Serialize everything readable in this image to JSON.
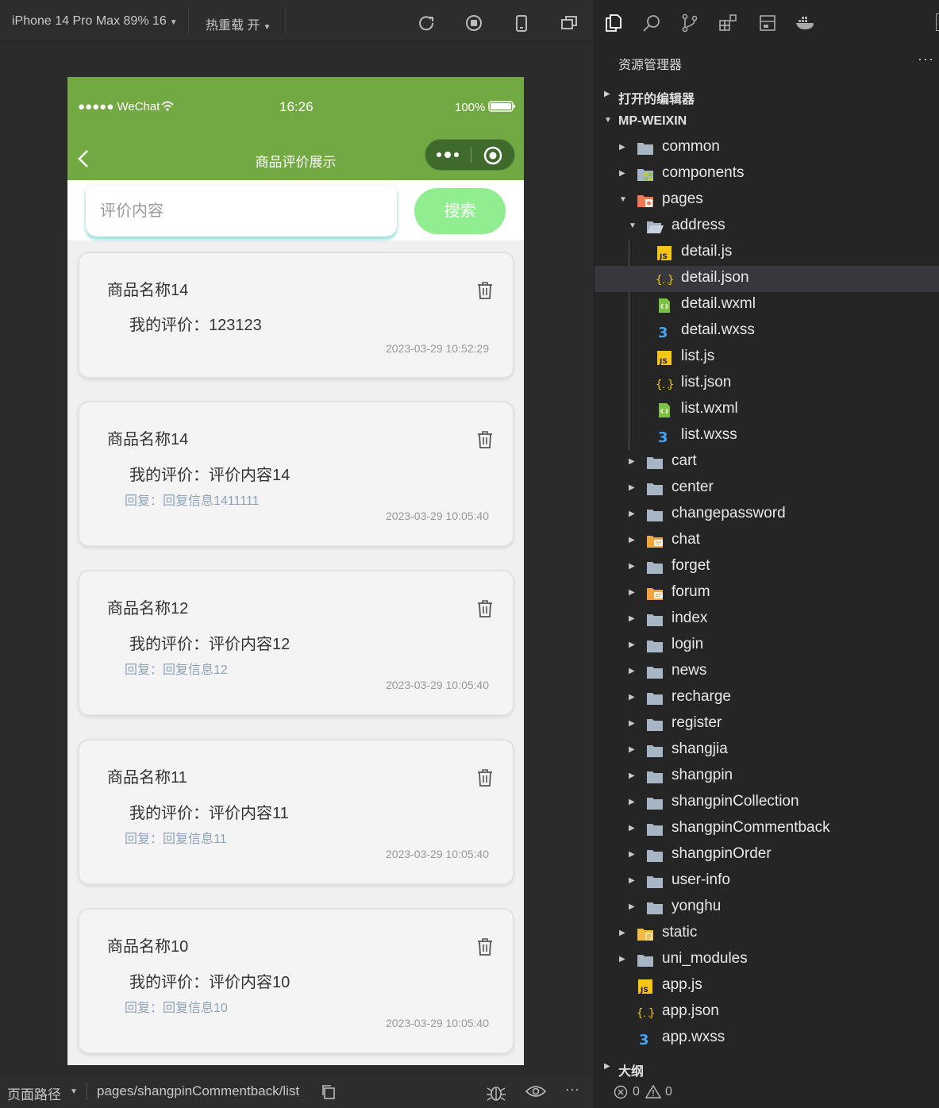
{
  "simulator": {
    "device_label": "iPhone 14 Pro Max 89% 16",
    "hot_reload_label": "热重载 开",
    "status_bar": {
      "carrier": "●●●●● WeChat",
      "time": "16:26",
      "battery": "100%"
    },
    "nav_title": "商品评价展示",
    "search": {
      "placeholder": "评价内容",
      "button": "搜索"
    },
    "comments": [
      {
        "name": "商品名称14",
        "mine": "我的评价：123123",
        "reply": "",
        "time": "2023-03-29 10:52:29"
      },
      {
        "name": "商品名称14",
        "mine": "我的评价：评价内容14",
        "reply": "回复：回复信息1411111",
        "time": "2023-03-29 10:05:40"
      },
      {
        "name": "商品名称12",
        "mine": "我的评价：评价内容12",
        "reply": "回复：回复信息12",
        "time": "2023-03-29 10:05:40"
      },
      {
        "name": "商品名称11",
        "mine": "我的评价：评价内容11",
        "reply": "回复：回复信息11",
        "time": "2023-03-29 10:05:40"
      },
      {
        "name": "商品名称10",
        "mine": "我的评价：评价内容10",
        "reply": "回复：回复信息10",
        "time": "2023-03-29 10:05:40"
      }
    ],
    "statusbar": {
      "path_label": "页面路径",
      "path": "pages/shangpinCommentback/list"
    }
  },
  "explorer": {
    "title": "资源管理器",
    "more": "···",
    "open_editors": "打开的编辑器",
    "project": "MP-WEIXIN",
    "outline": "大纲",
    "errors": "0",
    "warnings": "0",
    "tree": [
      {
        "label": "common",
        "type": "folder",
        "depth": 0,
        "expanded": false
      },
      {
        "label": "components",
        "type": "folder-components",
        "depth": 0,
        "expanded": false
      },
      {
        "label": "pages",
        "type": "folder-pages",
        "depth": 0,
        "expanded": true
      },
      {
        "label": "address",
        "type": "folder-open",
        "depth": 1,
        "expanded": true
      },
      {
        "label": "detail.js",
        "type": "js",
        "depth": 2
      },
      {
        "label": "detail.json",
        "type": "json",
        "depth": 2,
        "selected": true
      },
      {
        "label": "detail.wxml",
        "type": "wxml",
        "depth": 2
      },
      {
        "label": "detail.wxss",
        "type": "wxss",
        "depth": 2
      },
      {
        "label": "list.js",
        "type": "js",
        "depth": 2
      },
      {
        "label": "list.json",
        "type": "json",
        "depth": 2
      },
      {
        "label": "list.wxml",
        "type": "wxml",
        "depth": 2
      },
      {
        "label": "list.wxss",
        "type": "wxss",
        "depth": 2
      },
      {
        "label": "cart",
        "type": "folder",
        "depth": 1,
        "expanded": false
      },
      {
        "label": "center",
        "type": "folder",
        "depth": 1,
        "expanded": false
      },
      {
        "label": "changepassword",
        "type": "folder",
        "depth": 1,
        "expanded": false
      },
      {
        "label": "chat",
        "type": "folder-chat",
        "depth": 1,
        "expanded": false
      },
      {
        "label": "forget",
        "type": "folder",
        "depth": 1,
        "expanded": false
      },
      {
        "label": "forum",
        "type": "folder-chat",
        "depth": 1,
        "expanded": false
      },
      {
        "label": "index",
        "type": "folder",
        "depth": 1,
        "expanded": false
      },
      {
        "label": "login",
        "type": "folder",
        "depth": 1,
        "expanded": false
      },
      {
        "label": "news",
        "type": "folder",
        "depth": 1,
        "expanded": false
      },
      {
        "label": "recharge",
        "type": "folder",
        "depth": 1,
        "expanded": false
      },
      {
        "label": "register",
        "type": "folder",
        "depth": 1,
        "expanded": false
      },
      {
        "label": "shangjia",
        "type": "folder",
        "depth": 1,
        "expanded": false
      },
      {
        "label": "shangpin",
        "type": "folder",
        "depth": 1,
        "expanded": false
      },
      {
        "label": "shangpinCollection",
        "type": "folder",
        "depth": 1,
        "expanded": false
      },
      {
        "label": "shangpinCommentback",
        "type": "folder",
        "depth": 1,
        "expanded": false
      },
      {
        "label": "shangpinOrder",
        "type": "folder",
        "depth": 1,
        "expanded": false
      },
      {
        "label": "user-info",
        "type": "folder",
        "depth": 1,
        "expanded": false
      },
      {
        "label": "yonghu",
        "type": "folder",
        "depth": 1,
        "expanded": false
      },
      {
        "label": "static",
        "type": "folder-static",
        "depth": 0,
        "expanded": false
      },
      {
        "label": "uni_modules",
        "type": "folder",
        "depth": 0,
        "expanded": false
      },
      {
        "label": "app.js",
        "type": "js",
        "depth": 0
      },
      {
        "label": "app.json",
        "type": "json",
        "depth": 0
      },
      {
        "label": "app.wxss",
        "type": "wxss",
        "depth": 0
      }
    ]
  }
}
